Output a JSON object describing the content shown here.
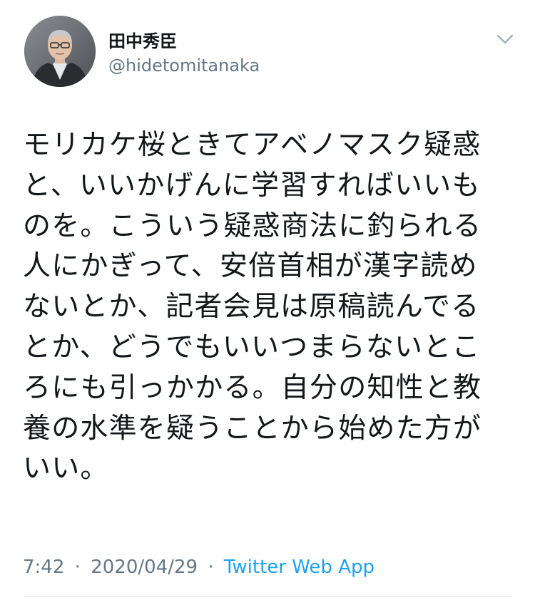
{
  "author": {
    "display_name": "田中秀臣",
    "handle": "@hidetomitanaka"
  },
  "tweet": {
    "lines": [
      "モリカケ桜ときてアベノマスク疑惑",
      "と、いいかげんに学習すればいいも",
      "のを。こういう疑惑商法に釣られる",
      "人にかぎって、安倍首相が漢字読め",
      "ないとか、記者会見は原稿読んでる",
      "とか、どうでもいいつまらないとこ",
      "ろにも引っかかる。自分の知性と教",
      "養の水準を疑うことから始めた方が",
      "いい。"
    ],
    "time": "7:42",
    "separator": "·",
    "date": "2020/04/29",
    "source": "Twitter Web App"
  },
  "icons": {
    "caret": "chevron-down-icon",
    "avatar": "profile-photo"
  },
  "colors": {
    "text": "#14171a",
    "secondary": "#657786",
    "link": "#1da1f2",
    "divider": "#e1e8ed"
  }
}
